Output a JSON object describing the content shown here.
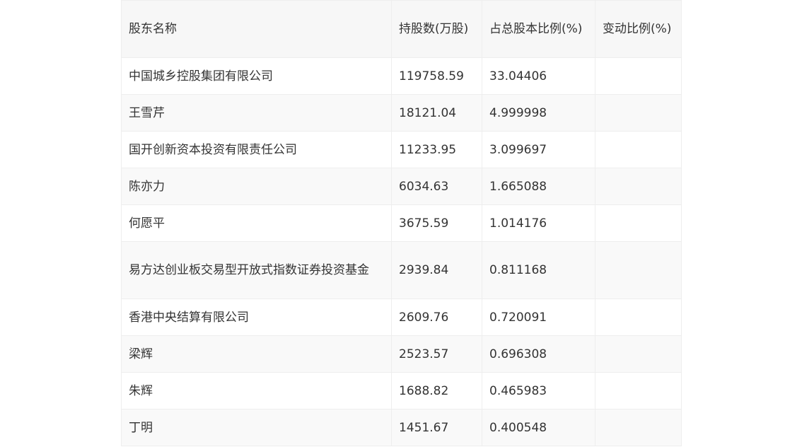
{
  "table": {
    "headers": [
      "股东名称",
      "持股数(万股)",
      "占总股本比例(%)",
      "变动比例(%)"
    ],
    "rows": [
      [
        "中国城乡控股集团有限公司",
        "119758.59",
        "33.04406",
        ""
      ],
      [
        "王雪芹",
        "18121.04",
        "4.999998",
        ""
      ],
      [
        "国开创新资本投资有限责任公司",
        "11233.95",
        "3.099697",
        ""
      ],
      [
        "陈亦力",
        "6034.63",
        "1.665088",
        ""
      ],
      [
        "何愿平",
        "3675.59",
        "1.014176",
        ""
      ],
      [
        "易方达创业板交易型开放式指数证券投资基金",
        "2939.84",
        "0.811168",
        ""
      ],
      [
        "香港中央结算有限公司",
        "2609.76",
        "0.720091",
        ""
      ],
      [
        "梁辉",
        "2523.57",
        "0.696308",
        ""
      ],
      [
        "朱辉",
        "1688.82",
        "0.465983",
        ""
      ],
      [
        "丁明",
        "1451.67",
        "0.400548",
        ""
      ]
    ]
  }
}
